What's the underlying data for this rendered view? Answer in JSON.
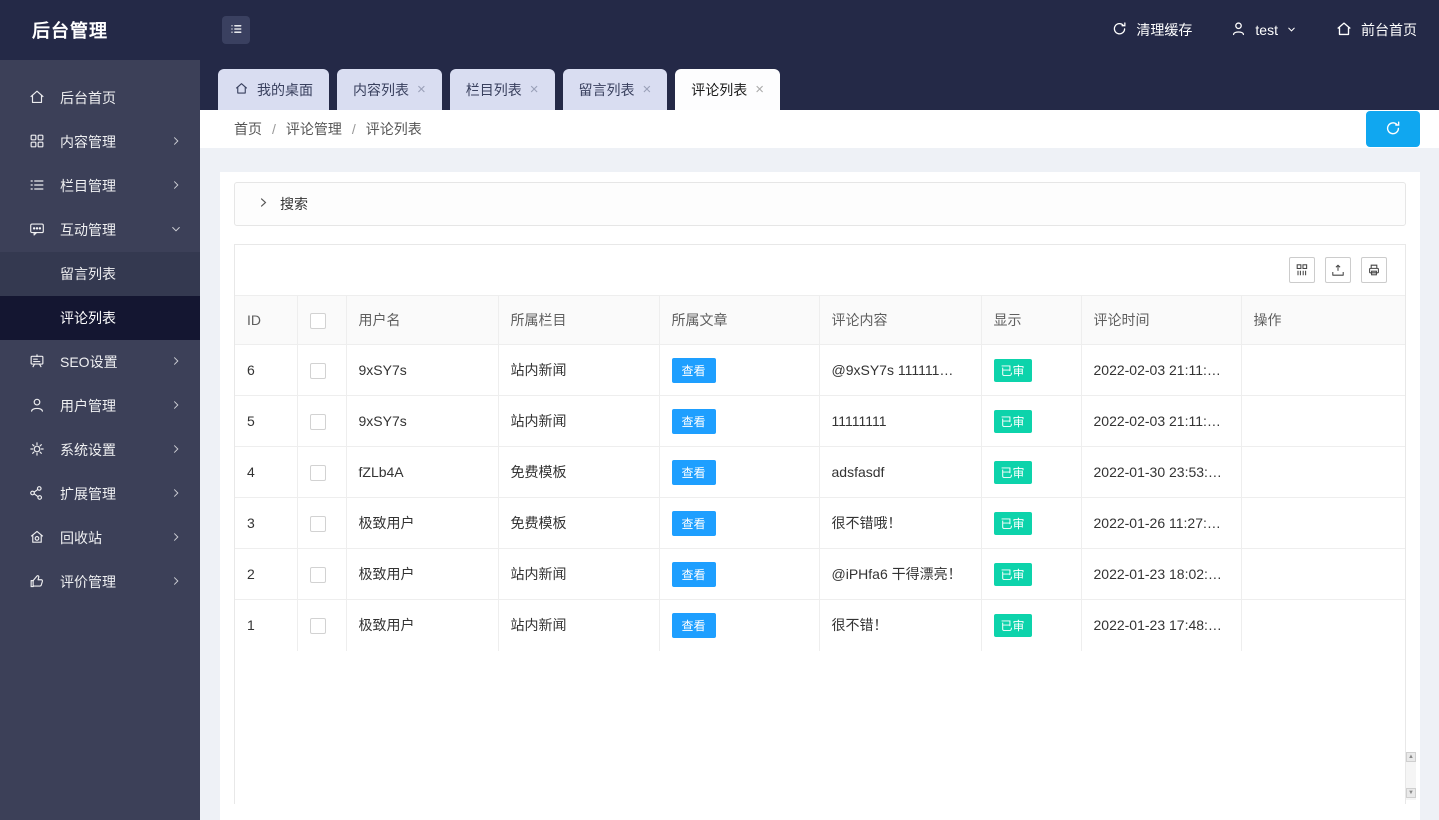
{
  "header": {
    "title": "后台管理",
    "clear_cache": "清理缓存",
    "username": "test",
    "front_home": "前台首页"
  },
  "sidebar": {
    "items": [
      {
        "label": "后台首页"
      },
      {
        "label": "内容管理"
      },
      {
        "label": "栏目管理"
      },
      {
        "label": "互动管理"
      },
      {
        "label": "SEO设置"
      },
      {
        "label": "用户管理"
      },
      {
        "label": "系统设置"
      },
      {
        "label": "扩展管理"
      },
      {
        "label": "回收站"
      },
      {
        "label": "评价管理"
      }
    ],
    "sub_items": [
      {
        "label": "留言列表",
        "active": false
      },
      {
        "label": "评论列表",
        "active": true
      }
    ]
  },
  "tabs": {
    "items": [
      {
        "label": "我的桌面",
        "closable": false,
        "active": false
      },
      {
        "label": "内容列表",
        "closable": true,
        "active": false
      },
      {
        "label": "栏目列表",
        "closable": true,
        "active": false
      },
      {
        "label": "留言列表",
        "closable": true,
        "active": false
      },
      {
        "label": "评论列表",
        "closable": true,
        "active": true
      }
    ]
  },
  "breadcrumb": {
    "items": [
      "首页",
      "评论管理",
      "评论列表"
    ],
    "separator": "/"
  },
  "search": {
    "label": "搜索"
  },
  "toolbar_icons": [
    "columns-filter-icon",
    "export-icon",
    "print-icon"
  ],
  "table": {
    "columns": {
      "id": "ID",
      "username": "用户名",
      "category": "所属栏目",
      "article": "所属文章",
      "content": "评论内容",
      "display": "显示",
      "time": "评论时间",
      "actions": "操作"
    },
    "view_label": "查看",
    "rows": [
      {
        "id": "6",
        "username": "9xSY7s",
        "category": "站内新闻",
        "content": "@9xSY7s 111111…",
        "status": "已审",
        "time": "2022-02-03 21:11:…"
      },
      {
        "id": "5",
        "username": "9xSY7s",
        "category": "站内新闻",
        "content": "11111111",
        "status": "已审",
        "time": "2022-02-03 21:11:…"
      },
      {
        "id": "4",
        "username": "fZLb4A",
        "category": "免费模板",
        "content": "adsfasdf",
        "status": "已审",
        "time": "2022-01-30 23:53:…"
      },
      {
        "id": "3",
        "username": "极致用户",
        "category": "免费模板",
        "content": "很不错哦！",
        "status": "已审",
        "time": "2022-01-26 11:27:…"
      },
      {
        "id": "2",
        "username": "极致用户",
        "category": "站内新闻",
        "content": "@iPHfa6 干得漂亮！",
        "status": "已审",
        "time": "2022-01-23 18:02:…"
      },
      {
        "id": "1",
        "username": "极致用户",
        "category": "站内新闻",
        "content": "很不错！",
        "status": "已审",
        "time": "2022-01-23 17:48:…"
      }
    ]
  },
  "icons": {
    "close": "×"
  },
  "colors": {
    "accent_blue": "#1e9fff",
    "refresh_blue": "#10a7f0",
    "badge_green": "#0dd3ab",
    "header_bg": "#242947",
    "sidebar_bg": "#3c4058",
    "active_item_bg": "#141631",
    "tab_bg": "#d9ddf1",
    "page_bg": "#eef1f6"
  }
}
